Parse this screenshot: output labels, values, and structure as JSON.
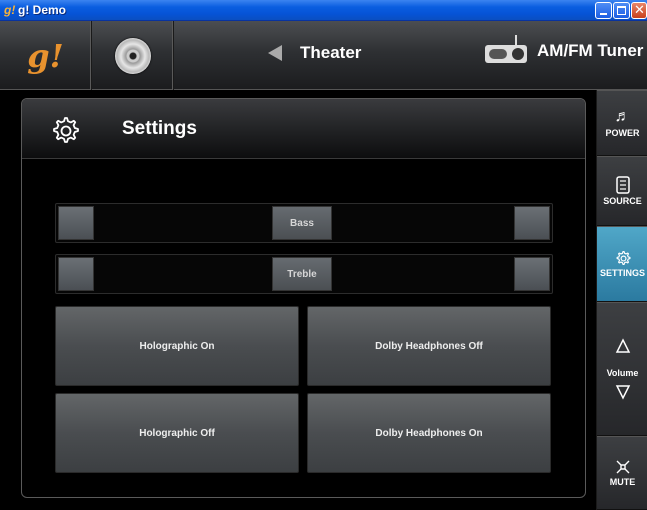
{
  "window": {
    "title": "g! Demo",
    "app_icon_text": "g!",
    "controls": [
      "minimize",
      "maximize",
      "close"
    ]
  },
  "toolbar": {
    "logo_text": "g!",
    "disc_icon": "disc-icon",
    "theater_label": "Theater",
    "tuner_label": "AM/FM Tuner"
  },
  "settings_panel": {
    "title": "Settings",
    "sliders": [
      {
        "label": "Bass",
        "value": 0.5
      },
      {
        "label": "Treble",
        "value": 0.5
      }
    ],
    "buttons": [
      "Holographic On",
      "Dolby Headphones Off",
      "Holographic Off",
      "Dolby Headphones On"
    ]
  },
  "sidebar": {
    "power": "POWER",
    "source": "SOURCE",
    "settings": "SETTINGS",
    "volume": "Volume",
    "mute": "MUTE"
  },
  "colors": {
    "accent_logo": "#e8922e",
    "active_tab": "#3b93b8",
    "titlebar": "#0a5ee0"
  }
}
